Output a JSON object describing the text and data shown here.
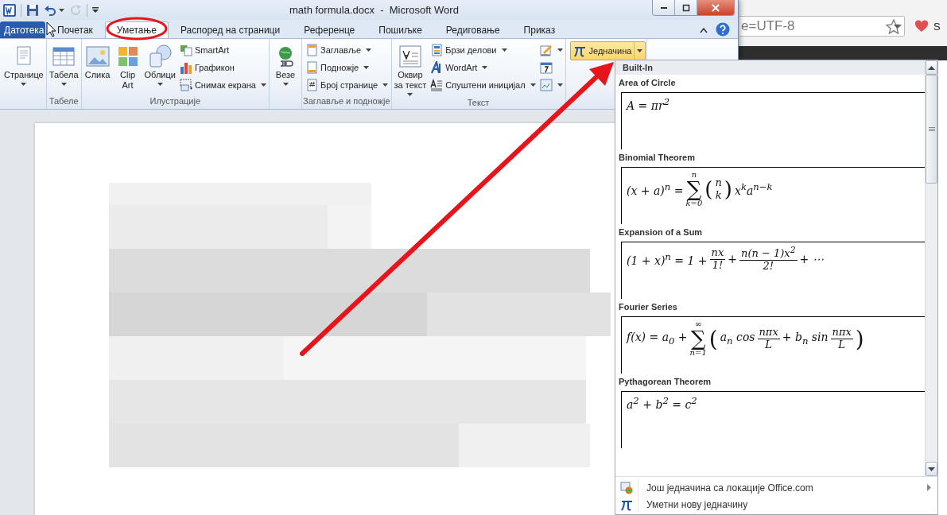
{
  "browser": {
    "address": "e=UTF-8",
    "bookmark": "S"
  },
  "window": {
    "title": "math formula.docx  -  Microsoft Word"
  },
  "quick_access": [
    {
      "disabled": false
    },
    {
      "disabled": false
    },
    {
      "disabled": true
    }
  ],
  "tabs": [
    {
      "label": "Датотека",
      "kind": "file",
      "selected": false
    },
    {
      "label": "Почетак",
      "kind": "tab",
      "selected": false
    },
    {
      "label": "Уметање",
      "kind": "tab",
      "selected": true
    },
    {
      "label": "Распоред на страници",
      "kind": "tab",
      "selected": false
    },
    {
      "label": "Референце",
      "kind": "tab",
      "selected": false
    },
    {
      "label": "Пошиљке",
      "kind": "tab",
      "selected": false
    },
    {
      "label": "Редиговање",
      "kind": "tab",
      "selected": false
    },
    {
      "label": "Приказ",
      "kind": "tab",
      "selected": false
    }
  ],
  "ribbon": {
    "groups": [
      {
        "controls": [
          {
            "kind": "large",
            "label": "Странице",
            "dropdown": true
          }
        ]
      },
      {
        "label": "Табеле",
        "controls": [
          {
            "kind": "large",
            "label": "Табела",
            "dropdown": true
          }
        ]
      },
      {
        "label": "Илустрације",
        "controls": [
          {
            "kind": "large",
            "label": "Слика",
            "dropdown": false
          },
          {
            "kind": "large",
            "label": "Clip\nArt",
            "dropdown": false
          },
          {
            "kind": "large",
            "label": "Облици",
            "dropdown": true
          },
          {
            "kind": "small",
            "label": "SmartArt",
            "dropdown": false
          },
          {
            "kind": "small",
            "label": "Графикон",
            "dropdown": false
          },
          {
            "kind": "small",
            "label": "Снимак екрана",
            "dropdown": true
          }
        ]
      },
      {
        "controls": [
          {
            "kind": "large",
            "label": "Везе",
            "dropdown": true
          }
        ]
      },
      {
        "label": "Заглавље и подножје",
        "controls": [
          {
            "kind": "small",
            "label": "Заглавље",
            "dropdown": true
          },
          {
            "kind": "small",
            "label": "Подножје",
            "dropdown": true
          },
          {
            "kind": "small",
            "label": "Број странице",
            "dropdown": true
          }
        ]
      },
      {
        "label": "Текст",
        "controls": [
          {
            "kind": "large",
            "label": "Оквир\nза текст",
            "dropdown": true
          },
          {
            "kind": "small",
            "label": "Брзи делови",
            "dropdown": true
          },
          {
            "kind": "small",
            "label": "WordArt",
            "dropdown": true
          },
          {
            "kind": "small",
            "label": "Спуштени иницијал",
            "dropdown": true
          },
          {
            "kind": "icon",
            "dropdown": true
          },
          {
            "kind": "icon",
            "dropdown": false
          },
          {
            "kind": "icon",
            "dropdown": true
          }
        ]
      },
      {
        "controls": [
          {
            "kind": "split",
            "label": "Једначина",
            "pressed": true
          }
        ]
      }
    ]
  },
  "gallery": {
    "header": "Built-In",
    "items": [
      {
        "title": "Area of Circle",
        "formula": [
          {
            "kind": "text",
            "text": "A = πr$^{2}$"
          }
        ]
      },
      {
        "title": "Binomial Theorem",
        "formula": [
          {
            "kind": "text",
            "text": "(x + a)$^{n}$ ="
          },
          {
            "kind": "sum",
            "symbol": "∑",
            "upper": "n",
            "lower": "k=0"
          },
          {
            "kind": "binom",
            "open": "(",
            "top": "n",
            "bottom": "k",
            "close": ")"
          },
          {
            "kind": "text",
            "text": "x$^{k}$a$^{n−k}$"
          }
        ]
      },
      {
        "title": "Expansion of a Sum",
        "formula": [
          {
            "kind": "text",
            "text": "(1 + x)$^{n}$ = 1 +"
          },
          {
            "kind": "frac",
            "num": "nx",
            "den": "1!"
          },
          {
            "kind": "text",
            "text": "+"
          },
          {
            "kind": "frac",
            "num": "n(n − 1)x$^{2}$",
            "den": "2!"
          },
          {
            "kind": "text",
            "text": "+ ⋯"
          }
        ]
      },
      {
        "title": "Fourier Series",
        "formula": [
          {
            "kind": "text",
            "text": "f(x) = a$_{0}$ +"
          },
          {
            "kind": "sum",
            "symbol": "∑",
            "upper": "∞",
            "lower": "n=1"
          },
          {
            "kind": "paren",
            "text": "("
          },
          {
            "kind": "text",
            "text": "a$_{n}$ cos"
          },
          {
            "kind": "frac",
            "num": "nπx",
            "den": "L"
          },
          {
            "kind": "text",
            "text": "+ b$_{n}$ sin"
          },
          {
            "kind": "frac",
            "num": "nπx",
            "den": "L"
          },
          {
            "kind": "paren",
            "text": ")"
          }
        ]
      },
      {
        "title": "Pythagorean Theorem",
        "formula": [
          {
            "kind": "text",
            "text": "a$^{2}$ + b$^{2}$ = c$^{2}$"
          }
        ]
      }
    ],
    "menu": [
      {
        "label": "Још једначина са локације Office.com",
        "submenu": true
      },
      {
        "label": "Уметни нову једначину",
        "submenu": false
      }
    ]
  }
}
